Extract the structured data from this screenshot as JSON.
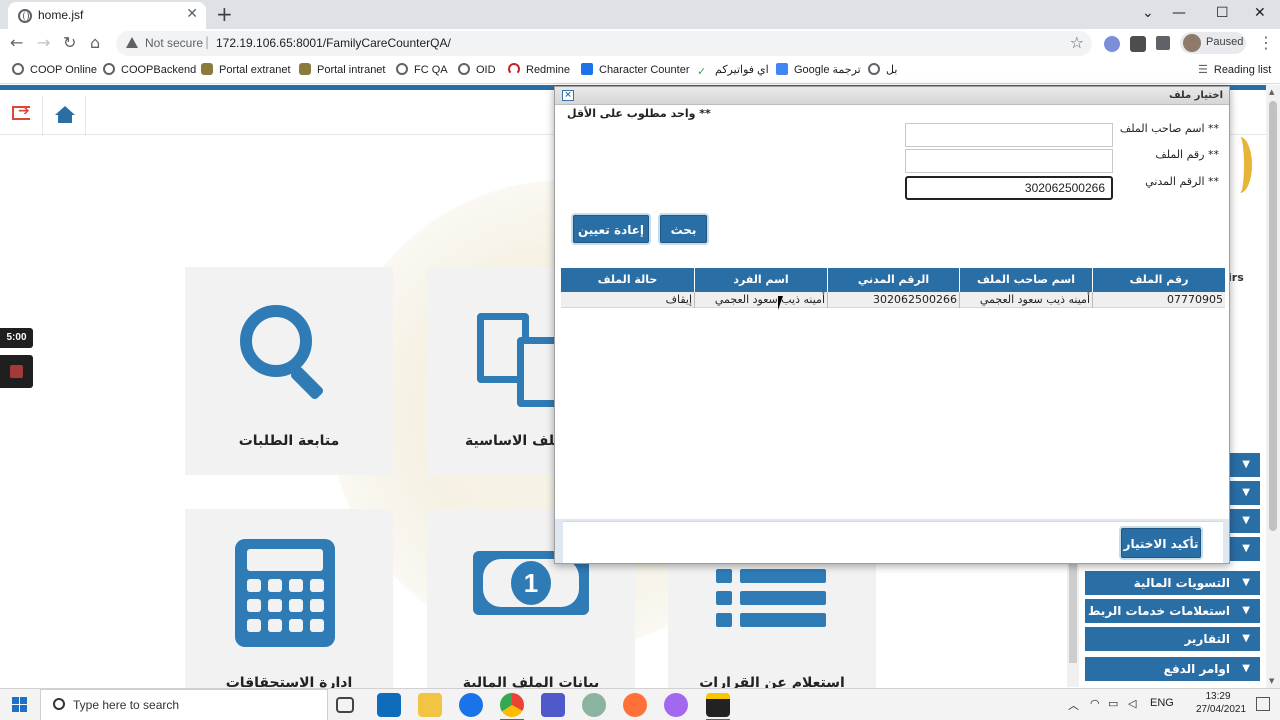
{
  "browser": {
    "tab_title": "home.jsf",
    "tab_close": "✕",
    "new_tab": "+",
    "window_controls": [
      "⌄",
      "—",
      "☐",
      "✕"
    ],
    "nav": {
      "back": "←",
      "forward": "→",
      "reload": "↻",
      "home": "⌂"
    },
    "address": {
      "security_text": "Not secure",
      "separator": "|",
      "url": "172.19.106.65:8001/FamilyCareCounterQA/"
    },
    "star": "☆",
    "profile": {
      "status": "Paused"
    },
    "menu": "⋮",
    "bookmarks": [
      {
        "label": "COOP Online",
        "icon": "globe-icon"
      },
      {
        "label": "COOPBackend",
        "icon": "globe-icon"
      },
      {
        "label": "Portal extranet",
        "icon": "emblem-icon"
      },
      {
        "label": "Portal intranet",
        "icon": "emblem-icon"
      },
      {
        "label": "FC QA",
        "icon": "globe-icon"
      },
      {
        "label": "OID",
        "icon": "globe-icon"
      },
      {
        "label": "Redmine",
        "icon": "redmine-icon"
      },
      {
        "label": "Character Counter",
        "icon": "counter-icon"
      },
      {
        "label": "اي فواتيركم",
        "icon": "leaf-icon"
      },
      {
        "label": "Google ترجمة",
        "icon": "google-translate-icon"
      },
      {
        "label": "بل",
        "icon": "globe-icon"
      }
    ],
    "reading_list": "Reading list"
  },
  "page": {
    "tiles": [
      {
        "label": "متابعة الطلبات",
        "icon": "search-icon"
      },
      {
        "label": "الملف الاساسية",
        "icon": "files-icon"
      },
      {
        "label": "ادارة الاستحقاقات والمديونيات",
        "icon": "calculator-icon"
      },
      {
        "label": "بيانات الملف المالية",
        "icon": "money-icon"
      },
      {
        "label": "استعلام عن القرارات",
        "icon": "list-icon"
      }
    ],
    "right_menu": [
      {
        "label": "",
        "arrow": "▼"
      },
      {
        "label": "",
        "arrow": "▼"
      },
      {
        "label": "",
        "arrow": "▼"
      },
      {
        "label": "",
        "arrow": "▼"
      },
      {
        "label": "التسويات المالية",
        "arrow": "▼"
      },
      {
        "label": "استعلامات خدمات الربط",
        "arrow": "▼"
      },
      {
        "label": "التقارير",
        "arrow": "▼"
      },
      {
        "label": "اوامر الدفع",
        "arrow": "▼"
      }
    ],
    "logo_fragment_text": "irs",
    "recorder": {
      "timer": "5:00"
    }
  },
  "dialog": {
    "title": "اختيار ملف",
    "close": "×",
    "required_note": "** واحد مطلوب على الأقل",
    "fields": {
      "owner_name": {
        "label": "** اسم صاحب الملف",
        "value": ""
      },
      "file_number": {
        "label": "** رقم الملف",
        "value": ""
      },
      "civil_id": {
        "label": "** الرقم المدني",
        "value": "302062500266"
      }
    },
    "search_button": "بحث",
    "reset_button": "إعادة تعيين",
    "table": {
      "columns": [
        "رقم الملف",
        "اسم صاحب الملف",
        "الرقم المدني",
        "اسم الفرد",
        "حالة الملف"
      ],
      "rows": [
        [
          "07770905",
          "أمينه ذيب سعود العجمي",
          "302062500266",
          "أمينه ذيب سعود العجمي",
          "إيقاف"
        ]
      ]
    },
    "confirm_button": "تأكيد الاختيار"
  },
  "taskbar": {
    "search_placeholder": "Type here to search",
    "tray": {
      "chevron": "︿",
      "language": "ENG",
      "time": "13:29",
      "date": "27/04/2021"
    }
  }
}
